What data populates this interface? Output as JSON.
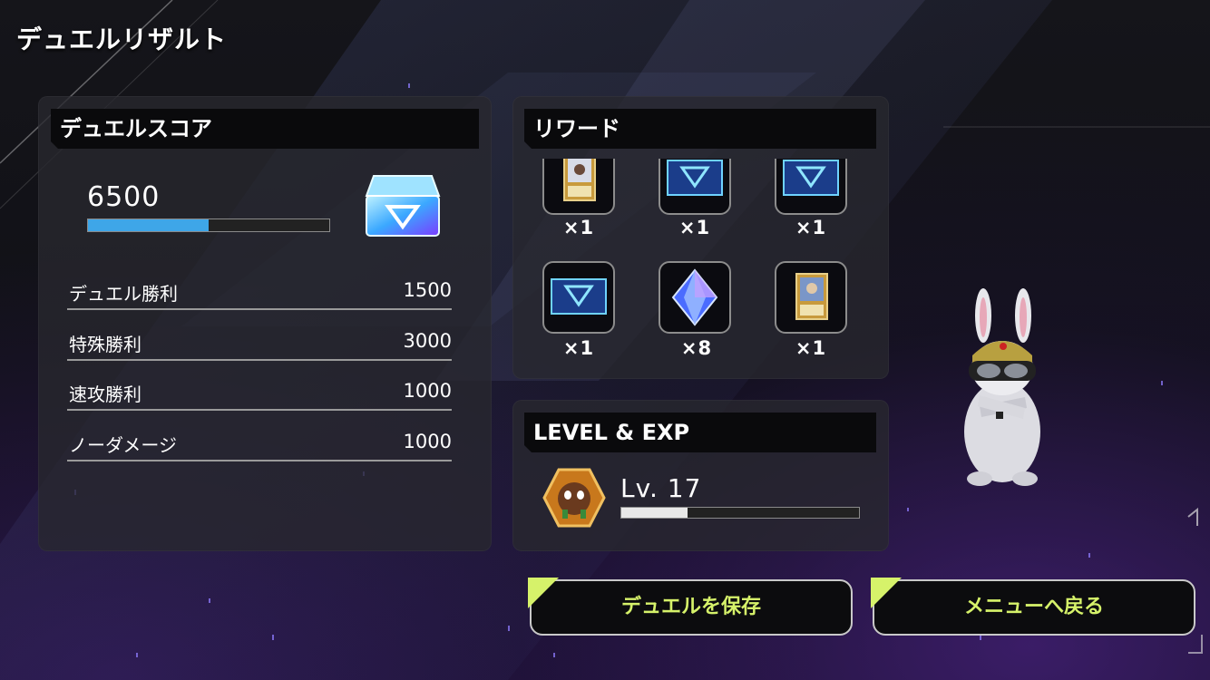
{
  "screen": {
    "title": "デュエルリザルト"
  },
  "score_panel": {
    "header": "デュエルスコア",
    "total": "6500",
    "progress": 0.5,
    "chest_icon": "treasure-chest-icon",
    "rows": [
      {
        "label": "デュエル勝利",
        "value": "1500"
      },
      {
        "label": "特殊勝利",
        "value": "3000"
      },
      {
        "label": "速攻勝利",
        "value": "1000"
      },
      {
        "label": "ノーダメージ",
        "value": "1000"
      }
    ]
  },
  "reward_panel": {
    "header": "リワード",
    "items": [
      {
        "icon": "monster-card-icon",
        "count": "×1"
      },
      {
        "icon": "card-pack-icon",
        "count": "×1"
      },
      {
        "icon": "card-pack-icon",
        "count": "×1"
      },
      {
        "icon": "card-pack-icon",
        "count": "×1"
      },
      {
        "icon": "gem-icon",
        "count": "×8"
      },
      {
        "icon": "monster-card-icon",
        "count": "×1"
      }
    ]
  },
  "level_panel": {
    "header": "LEVEL & EXP",
    "level_text": "Lv. 17",
    "progress": 0.28,
    "avatar_icon": "kuriboh-avatar-icon"
  },
  "buttons": {
    "save": "デュエルを保存",
    "menu": "メニューへ戻る"
  },
  "mate": {
    "icon": "rabbit-mate-icon"
  },
  "colors": {
    "accent": "#d6f26a",
    "score_bar": "#3ea6e8",
    "exp_bar": "#e8e8e8"
  }
}
